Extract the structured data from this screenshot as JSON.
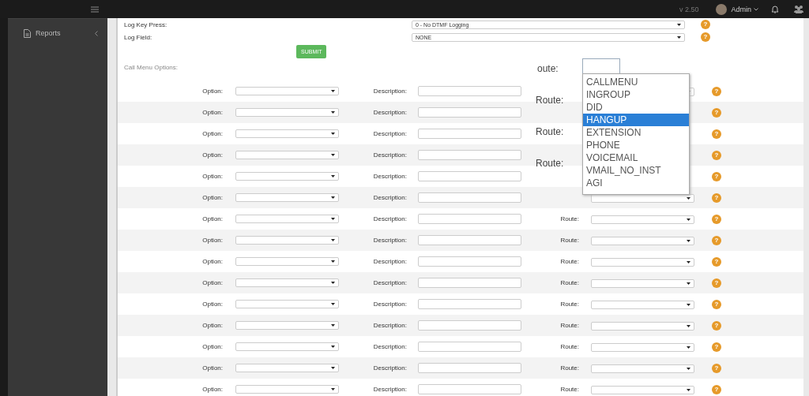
{
  "topbar": {
    "version": "v 2.50",
    "user": "Admin"
  },
  "sidebar": {
    "items": [
      {
        "label": "Reports"
      }
    ]
  },
  "settings": [
    {
      "label": "Log Key Press:",
      "value": "0 - No DTMF Logging",
      "help": "?"
    },
    {
      "label": "Log Field:",
      "value": "NONE",
      "help": "?"
    }
  ],
  "submit": "SUBMIT",
  "section_title": "Call Menu Options:",
  "rows": [
    {
      "kind": "full",
      "option_label": "Option:",
      "description_label": "Description:",
      "help": "?"
    },
    {
      "kind": "covered",
      "option_label": "Option:",
      "description_label": "Description:",
      "help": "?"
    },
    {
      "kind": "covered",
      "option_label": "Option:",
      "description_label": "Description:",
      "help": "?"
    },
    {
      "kind": "covered",
      "option_label": "Option:",
      "description_label": "Description:",
      "help": "?"
    },
    {
      "kind": "covered",
      "option_label": "Option:",
      "description_label": "Description:",
      "help": "?"
    },
    {
      "kind": "full",
      "option_label": "Option:",
      "description_label": "Description:",
      "help": "?"
    },
    {
      "kind": "full",
      "option_label": "Option:",
      "description_label": "Description:",
      "route_label": "Route:",
      "help": "?"
    },
    {
      "kind": "full",
      "option_label": "Option:",
      "description_label": "Description:",
      "route_label": "Route:",
      "help": "?"
    },
    {
      "kind": "full",
      "option_label": "Option:",
      "description_label": "Description:",
      "route_label": "Route:",
      "help": "?"
    },
    {
      "kind": "full",
      "option_label": "Option:",
      "description_label": "Description:",
      "route_label": "Route:",
      "help": "?"
    },
    {
      "kind": "full",
      "option_label": "Option:",
      "description_label": "Description:",
      "route_label": "Route:",
      "help": "?"
    },
    {
      "kind": "full",
      "option_label": "Option:",
      "description_label": "Description:",
      "route_label": "Route:",
      "help": "?"
    },
    {
      "kind": "full",
      "option_label": "Option:",
      "description_label": "Description:",
      "route_label": "Route:",
      "help": "?"
    },
    {
      "kind": "full",
      "option_label": "Option:",
      "description_label": "Description:",
      "route_label": "Route:",
      "help": "?"
    },
    {
      "kind": "full",
      "option_label": "Option:",
      "description_label": "Description:",
      "route_label": "Route:",
      "help": "?"
    }
  ],
  "route_dropdown": {
    "field_label": "oute:",
    "side_labels": [
      "Route:",
      "Route:",
      "Route:"
    ],
    "items": [
      {
        "label": "CALLMENU",
        "selected": false
      },
      {
        "label": "INGROUP",
        "selected": false
      },
      {
        "label": "DID",
        "selected": false
      },
      {
        "label": "HANGUP",
        "selected": true
      },
      {
        "label": "EXTENSION",
        "selected": false
      },
      {
        "label": "PHONE",
        "selected": false
      },
      {
        "label": "VOICEMAIL",
        "selected": false
      },
      {
        "label": "VMAIL_NO_INST",
        "selected": false
      },
      {
        "label": "AGI",
        "selected": false
      }
    ]
  }
}
